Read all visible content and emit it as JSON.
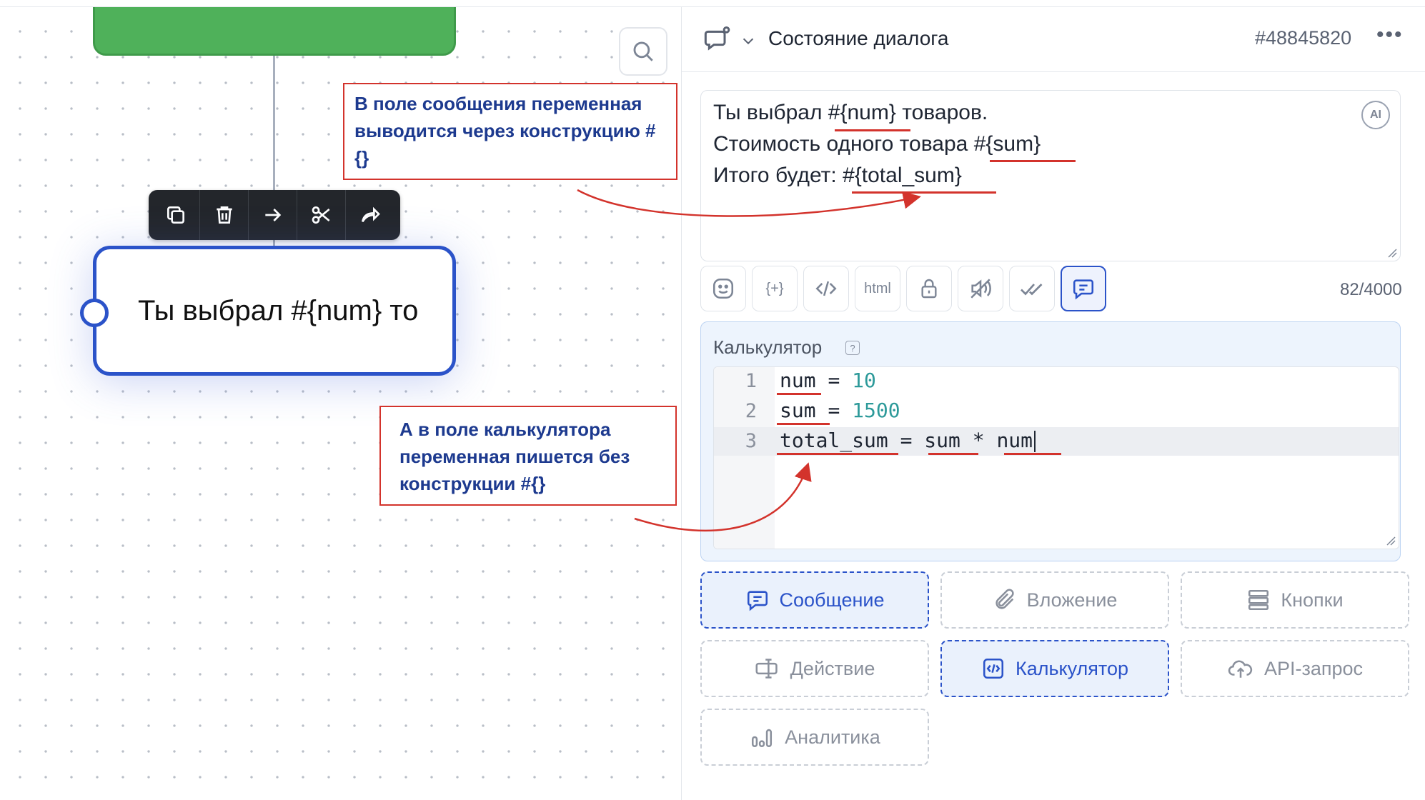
{
  "canvas": {
    "node_text": "Ты выбрал #{num} то",
    "note_message": "В поле сообщения переменная выводится через конструкцию #{}",
    "note_calculator": "А в поле калькулятора переменная пишется без конструкции #{}",
    "annotation_color": "#d3332c"
  },
  "header": {
    "title": "Состояние диалога",
    "dialog_id": "#48845820",
    "more": "•••"
  },
  "message": {
    "lines": [
      "Ты выбрал #{num} товаров.",
      "Стоимость одного товара #{sum}",
      "Итого будет: #{total_sum}"
    ],
    "ai_label": "AI",
    "counter": "82/4000"
  },
  "toolbar_icons": [
    "emoji-icon",
    "variable-icon",
    "code-icon",
    "html-icon",
    "lock-icon",
    "mute-icon",
    "double-check-icon",
    "message-icon"
  ],
  "toolbar_labels": {
    "variable": "{+}",
    "html": "html"
  },
  "calculator": {
    "label": "Калькулятор",
    "help": "?",
    "line_numbers": [
      "1",
      "2",
      "3"
    ],
    "code": [
      {
        "name": "num",
        "op": "=",
        "value": "10"
      },
      {
        "name": "sum",
        "op": "=",
        "value": "1500"
      },
      {
        "name": "total_sum",
        "op": "=",
        "expr": "sum * num"
      }
    ]
  },
  "blocks": [
    {
      "label": "Сообщение",
      "icon": "message-icon",
      "active": true
    },
    {
      "label": "Вложение",
      "icon": "attachment-icon",
      "active": false
    },
    {
      "label": "Кнопки",
      "icon": "buttons-icon",
      "active": false
    },
    {
      "label": "Действие",
      "icon": "action-icon",
      "active": false
    },
    {
      "label": "Калькулятор",
      "icon": "calculator-icon",
      "active": true
    },
    {
      "label": "API-запрос",
      "icon": "cloud-upload-icon",
      "active": false
    },
    {
      "label": "Аналитика",
      "icon": "analytics-icon",
      "active": false
    }
  ],
  "colors": {
    "accent": "#2b53c9",
    "node_green": "#4fb15a",
    "annotation": "#d3332c"
  }
}
